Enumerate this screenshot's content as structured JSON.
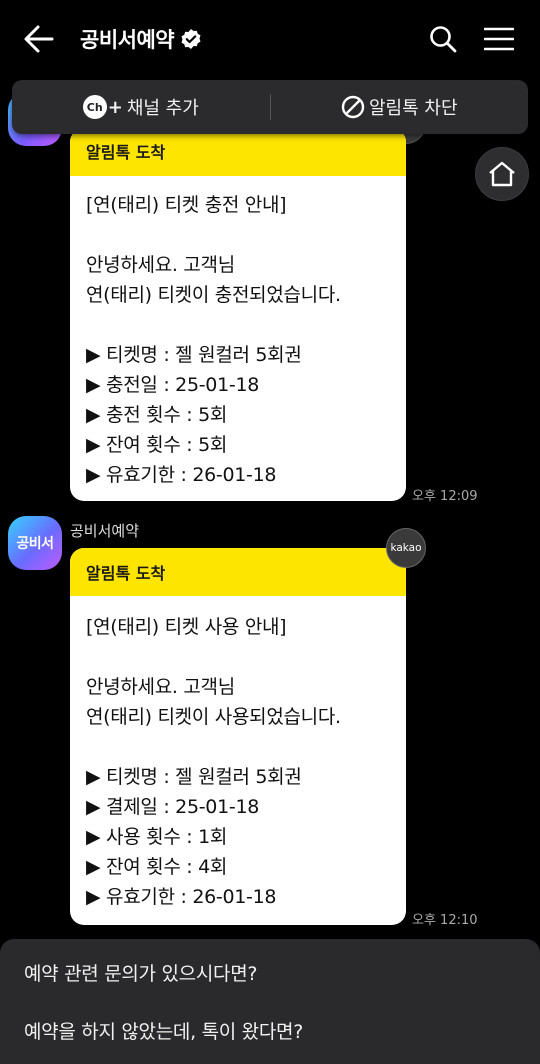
{
  "header": {
    "title": "공비서예약"
  },
  "channel_bar": {
    "add_channel_label": "채널 추가",
    "ch_badge": "Ch",
    "block_label": "알림톡 차단"
  },
  "messages": [
    {
      "head": "알림톡 도착",
      "lines": [
        "[연(태리) 티켓 충전 안내]",
        "",
        "안녕하세요. 고객님",
        "연(태리) 티켓이 충전되었습니다.",
        "",
        "▶ 티켓명 : 젤 원컬러 5회권",
        "▶ 충전일 : 25-01-18",
        "▶ 충전 횟수 : 5회",
        "▶ 잔여 횟수 : 5회",
        "▶ 유효기한 : 26-01-18"
      ],
      "time": "오후 12:09"
    },
    {
      "sender": "공비서예약",
      "avatar_text": "공비서",
      "kakao_badge": "kakao",
      "head": "알림톡 도착",
      "lines": [
        "[연(태리) 티켓 사용 안내]",
        "",
        "안녕하세요. 고객님",
        "연(태리) 티켓이 사용되었습니다.",
        "",
        "▶ 티켓명 : 젤 원컬러 5회권",
        "▶ 결제일 : 25-01-18",
        "▶ 사용 횟수 : 1회",
        "▶ 잔여 횟수 : 4회",
        "▶ 유효기한 : 26-01-18"
      ],
      "time": "오후 12:10"
    }
  ],
  "bottom_sheet": {
    "items": [
      "예약 관련 문의가 있으시다면?",
      "예약을 하지 않았는데, 톡이 왔다면?"
    ]
  },
  "colors": {
    "card_header": "#fee500",
    "background": "#000000",
    "sheet": "#2a2a2c"
  }
}
